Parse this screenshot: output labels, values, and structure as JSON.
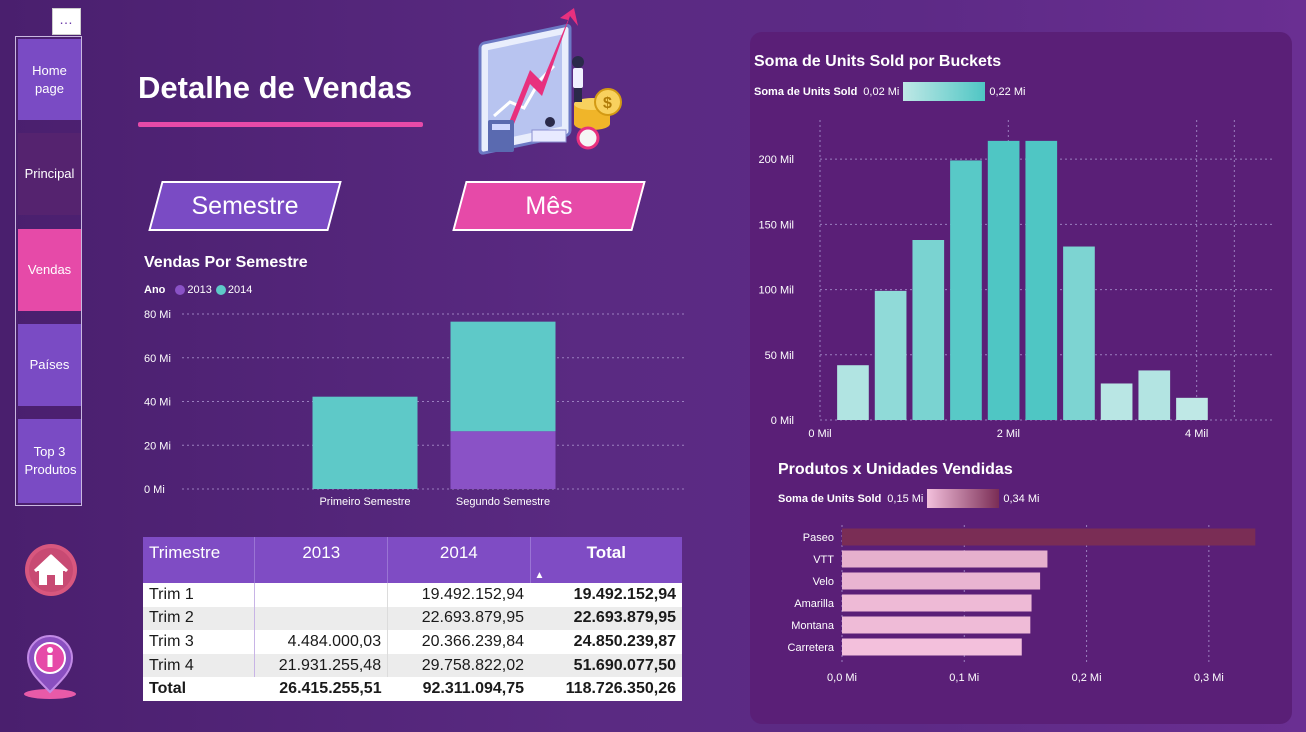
{
  "nav": {
    "items": [
      {
        "label": "Home page"
      },
      {
        "label": "Principal"
      },
      {
        "label": "Vendas"
      },
      {
        "label": "Países"
      },
      {
        "label": "Top 3 Produtos"
      }
    ]
  },
  "header": {
    "title": "Detalhe de Vendas"
  },
  "buttons": {
    "semestre": "Semestre",
    "mes": "Mês"
  },
  "semestre_chart": {
    "title": "Vendas Por Semestre",
    "legend_label": "Ano",
    "colors": {
      "2013": "#8a52c6",
      "2014": "#5ec9c8"
    }
  },
  "buckets_chart": {
    "title": "Soma de Units Sold por Buckets",
    "legend_label": "Soma de Units Sold",
    "legend_min": "0,02 Mi",
    "legend_max": "0,22 Mi"
  },
  "produtos_chart": {
    "title": "Produtos x Unidades Vendidas",
    "legend_label": "Soma de Units Sold",
    "legend_min": "0,15 Mi",
    "legend_max": "0,34 Mi"
  },
  "table": {
    "headers": [
      "Trimestre",
      "2013",
      "2014",
      "Total"
    ],
    "rows": [
      [
        "Trim 1",
        "",
        "19.492.152,94",
        "19.492.152,94"
      ],
      [
        "Trim 2",
        "",
        "22.693.879,95",
        "22.693.879,95"
      ],
      [
        "Trim 3",
        "4.484.000,03",
        "20.366.239,84",
        "24.850.239,87"
      ],
      [
        "Trim 4",
        "21.931.255,48",
        "29.758.822,02",
        "51.690.077,50"
      ]
    ],
    "total_row": [
      "Total",
      "26.415.255,51",
      "92.311.094,75",
      "118.726.350,26"
    ]
  },
  "chart_data": [
    {
      "type": "bar",
      "title": "Vendas Por Semestre",
      "stacked": true,
      "categories": [
        "Primeiro Semestre",
        "Segundo Semestre"
      ],
      "series": [
        {
          "name": "2013",
          "values": [
            0,
            26.4
          ]
        },
        {
          "name": "2014",
          "values": [
            42.2,
            50.1
          ]
        }
      ],
      "ylim": [
        0,
        80
      ],
      "yticks": [
        "0 Mi",
        "20 Mi",
        "40 Mi",
        "60 Mi",
        "80 Mi"
      ],
      "ytick_values": [
        0,
        20,
        40,
        60,
        80
      ],
      "legend": "top-left",
      "grid": true
    },
    {
      "type": "bar",
      "title": "Soma de Units Sold por Buckets",
      "x": [
        0.35,
        0.75,
        1.15,
        1.55,
        1.95,
        2.35,
        2.75,
        3.15,
        3.55,
        3.95
      ],
      "values": [
        42,
        99,
        138,
        199,
        214,
        214,
        133,
        28,
        38,
        17
      ],
      "xlim": [
        0,
        4.8
      ],
      "ylim": [
        0,
        230
      ],
      "xticks": [
        "0 Mil",
        "2 Mil",
        "4 Mil"
      ],
      "xtick_values": [
        0,
        2,
        4
      ],
      "yticks": [
        "0 Mil",
        "50 Mil",
        "100 Mil",
        "150 Mil",
        "200 Mil"
      ],
      "ytick_values": [
        0,
        50,
        100,
        150,
        200
      ],
      "color_min": "#bfe8e6",
      "color_max": "#4fc6c4",
      "grid": true
    },
    {
      "type": "bar",
      "orientation": "horizontal",
      "title": "Produtos x Unidades Vendidas",
      "categories": [
        "Paseo",
        "VTT",
        "Velo",
        "Amarilla",
        "Montana",
        "Carretera"
      ],
      "values": [
        0.338,
        0.168,
        0.162,
        0.155,
        0.154,
        0.147
      ],
      "xlim": [
        0,
        0.35
      ],
      "xticks": [
        "0,0 Mi",
        "0,1 Mi",
        "0,2 Mi",
        "0,3 Mi"
      ],
      "xtick_values": [
        0,
        0.1,
        0.2,
        0.3
      ],
      "color_min": "#f3c0dc",
      "color_max": "#7a2d55",
      "grid": true
    }
  ]
}
